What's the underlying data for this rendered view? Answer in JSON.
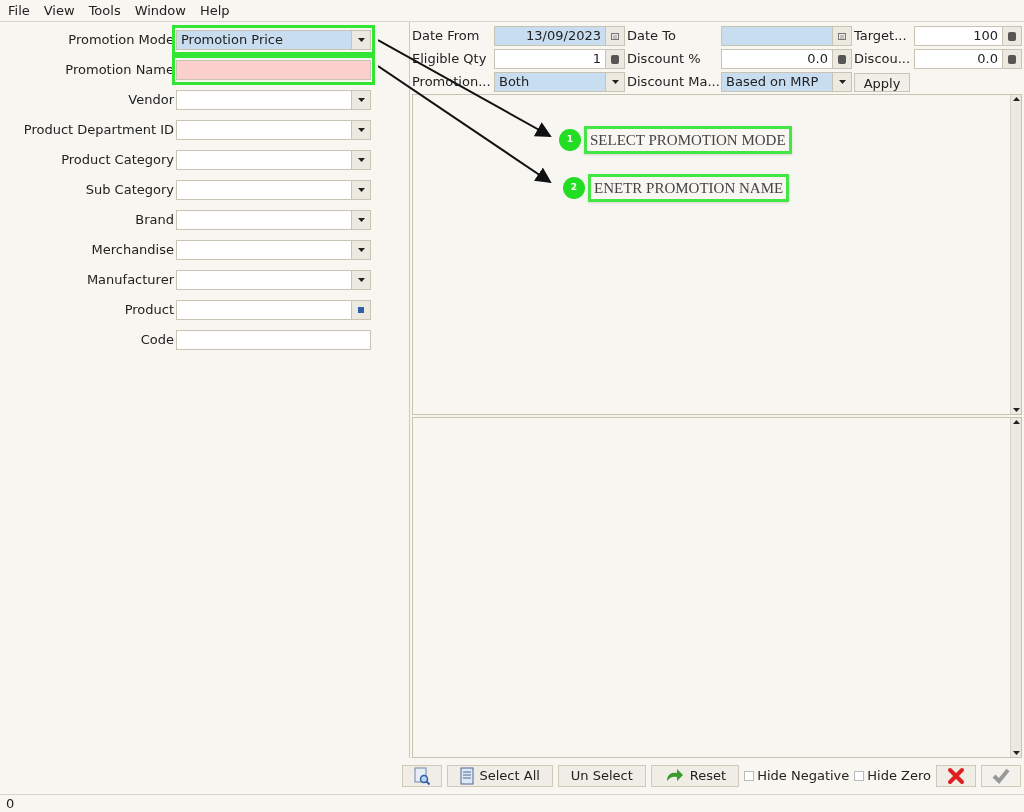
{
  "menu": [
    "File",
    "View",
    "Tools",
    "Window",
    "Help"
  ],
  "left_form": [
    {
      "label": "Promotion Mode",
      "kind": "combo",
      "value": "Promotion Price",
      "shaded": true,
      "required": false,
      "highlighted": true
    },
    {
      "label": "Promotion Name",
      "kind": "text",
      "required": true,
      "highlighted": true
    },
    {
      "label": "Vendor",
      "kind": "combo",
      "shaded": false,
      "required": false,
      "highlighted": false
    },
    {
      "label": "Product Department ID",
      "kind": "combo",
      "shaded": false,
      "required": false,
      "highlighted": false
    },
    {
      "label": "Product Category",
      "kind": "combo",
      "shaded": false,
      "required": false,
      "highlighted": false
    },
    {
      "label": "Sub Category",
      "kind": "combo",
      "shaded": false,
      "required": false,
      "highlighted": false
    },
    {
      "label": "Brand",
      "kind": "combo",
      "shaded": false,
      "required": false,
      "highlighted": false
    },
    {
      "label": "Merchandise",
      "kind": "combo",
      "shaded": false,
      "required": false,
      "highlighted": false
    },
    {
      "label": "Manufacturer",
      "kind": "combo",
      "shaded": false,
      "required": false,
      "highlighted": false
    },
    {
      "label": "Product",
      "kind": "lookup",
      "shaded": false,
      "required": false,
      "highlighted": false
    },
    {
      "label": "Code",
      "kind": "text",
      "shaded": false,
      "required": false,
      "highlighted": false
    }
  ],
  "top_form": [
    {
      "label": "Date From",
      "kind": "date",
      "value": "13/09/2023",
      "shaded": true
    },
    {
      "label": "Date To",
      "kind": "date",
      "shaded": true
    },
    {
      "label": "Target...",
      "kind": "number",
      "value": "100",
      "shaded": false
    },
    {
      "label": "Eligible Qty",
      "kind": "number",
      "value": "1",
      "shaded": false
    },
    {
      "label": "Discount %",
      "kind": "number",
      "value": "0.0",
      "shaded": false
    },
    {
      "label": "Discou...",
      "kind": "number",
      "value": "0.0",
      "shaded": false
    },
    {
      "label": "Promotion...",
      "kind": "combo",
      "value": "Both",
      "shaded": true
    },
    {
      "label": "Discount Ma...",
      "kind": "combo",
      "value": "Based on MRP",
      "shaded": true
    },
    {
      "label": "Apply",
      "kind": "button"
    }
  ],
  "annotations": [
    {
      "number": "1",
      "text": "SELECT PROMOTION MODE"
    },
    {
      "number": "2",
      "text": "ENETR PROMOTION NAME"
    }
  ],
  "toolbar": [
    {
      "kind": "icon_button"
    },
    {
      "kind": "button",
      "label": "Select All"
    },
    {
      "kind": "button",
      "label": "Un Select"
    },
    {
      "kind": "button",
      "label": "Reset"
    },
    {
      "kind": "checkbox",
      "label": "Hide Negative",
      "checked": false
    },
    {
      "kind": "checkbox",
      "label": "Hide Zero",
      "checked": false
    },
    {
      "kind": "icon_button"
    },
    {
      "kind": "icon_button",
      "disabled": true
    }
  ],
  "status_bar": "0"
}
